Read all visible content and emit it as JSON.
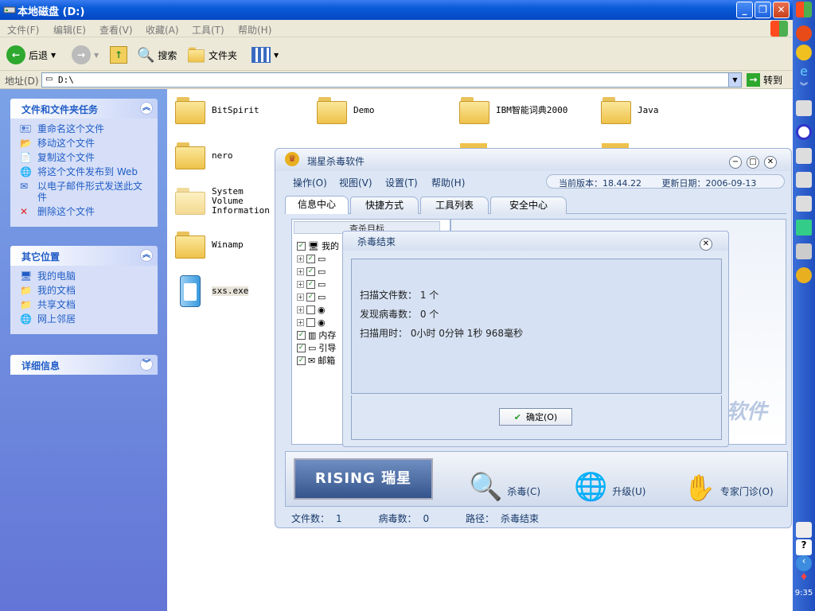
{
  "window": {
    "title": "本地磁盘 (D:)"
  },
  "menu": [
    "文件(F)",
    "编辑(E)",
    "查看(V)",
    "收藏(A)",
    "工具(T)",
    "帮助(H)"
  ],
  "toolbar": {
    "back": "后退",
    "search": "搜索",
    "folders": "文件夹"
  },
  "address": {
    "label": "地址(D)",
    "value": "D:\\",
    "go": "转到"
  },
  "panels": {
    "tasks": {
      "title": "文件和文件夹任务",
      "items": [
        "重命名这个文件",
        "移动这个文件",
        "复制这个文件",
        "将这个文件发布到 Web",
        "以电子邮件形式发送此文件",
        "删除这个文件"
      ]
    },
    "places": {
      "title": "其它位置",
      "items": [
        "我的电脑",
        "我的文档",
        "共享文档",
        "网上邻居"
      ]
    },
    "details": {
      "title": "详细信息"
    }
  },
  "files": [
    "BitSpirit",
    "Demo",
    "IBM智能词典2000",
    "Java",
    "nero",
    "System Volume Information",
    "Winamp",
    "sxs.exe"
  ],
  "rising": {
    "title": "瑞星杀毒软件",
    "menu": [
      "操作(O)",
      "视图(V)",
      "设置(T)",
      "帮助(H)"
    ],
    "version_label": "当前版本：",
    "version": "18.44.22",
    "date_label": "更新日期：",
    "date": "2006-09-13",
    "tabs": [
      "信息中心",
      "快捷方式",
      "工具列表",
      "安全中心"
    ],
    "tree_header": "查杀目标",
    "tree": [
      "我的",
      "内存",
      "引导",
      "邮箱"
    ],
    "logo": "RISING 瑞星",
    "brand": "软件",
    "buttons": [
      "杀毒(C)",
      "升级(U)",
      "专家门诊(O)"
    ],
    "status": {
      "files_label": "文件数：",
      "files": "1",
      "virus_label": "病毒数：",
      "virus": "0",
      "path_label": "路径：",
      "path": "杀毒结束"
    }
  },
  "dialog": {
    "title": "杀毒结束",
    "lines": [
      "扫描文件数： 1 个",
      "发现病毒数： 0 个",
      "扫描用时：  0小时 0分钟 1秒 968毫秒"
    ],
    "ok": "确定(O)"
  },
  "clock": "9:35",
  "colors": {
    "xp_blue": "#0a5bd8",
    "task_link": "#215dc6"
  }
}
